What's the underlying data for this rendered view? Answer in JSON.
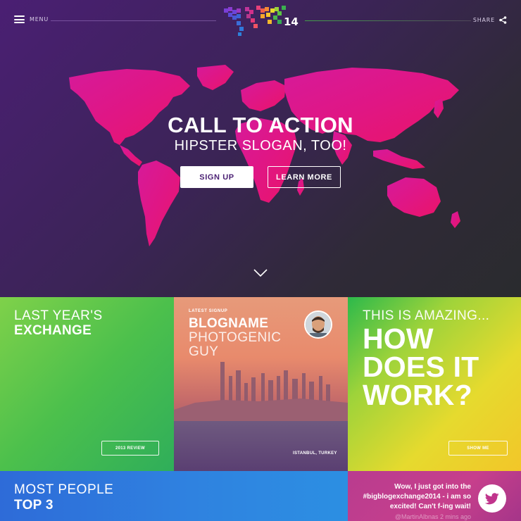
{
  "header": {
    "menu_label": "MENU",
    "share_label": "SHARE",
    "logo_number": "14"
  },
  "hero": {
    "title": "CALL TO ACTION",
    "subtitle": "HIPSTER SLOGAN, TOO!",
    "signup_label": "SIGN UP",
    "learn_more_label": "LEARN MORE"
  },
  "tiles": {
    "exchange": {
      "line1": "LAST YEAR'S",
      "line2": "EXCHANGE",
      "button_label": "2013 REVIEW"
    },
    "signup": {
      "tag": "LATEST SIGNUP",
      "blog_name": "BLOGNAME",
      "person": "PHOTOGENIC GUY",
      "location": "ISTANBUL, TURKEY"
    },
    "how": {
      "line1": "THIS IS AMAZING...",
      "headline": "HOW DOES IT WORK?",
      "button_label": "SHOW ME"
    },
    "people": {
      "line1": "MOST PEOPLE",
      "line2": "TOP 3"
    },
    "tweet": {
      "text": "Wow, I just got into the #bigblogexchange2014 - i am so excited! Can't f-ing wait!",
      "meta": "@MartinAlbnas 2 mins ago"
    }
  },
  "colors": {
    "hero_purple": "#4a1f73",
    "map_pink": "#e0157c",
    "tile_green": "#4cc04c",
    "tile_yellow": "#e6da2e",
    "tile_blue": "#2e6bd8",
    "tile_pink": "#c73f8c"
  },
  "icons": [
    "hamburger-menu-icon",
    "share-icon",
    "chevron-down-icon",
    "twitter-bird-icon"
  ]
}
